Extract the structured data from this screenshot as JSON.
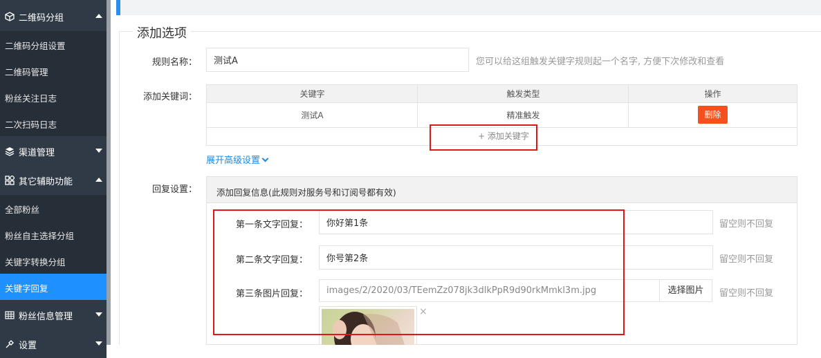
{
  "sidebar": {
    "groups": [
      {
        "label": "二维码分组",
        "icon": "cube-icon",
        "expanded": true
      },
      {
        "label": "渠道管理",
        "icon": "layers-icon",
        "expanded": false
      },
      {
        "label": "其它辅助功能",
        "icon": "apps-icon",
        "expanded": true
      },
      {
        "label": "粉丝信息管理",
        "icon": "table-icon",
        "expanded": false
      },
      {
        "label": "设置",
        "icon": "tools-icon",
        "expanded": false
      }
    ],
    "items_group1": [
      "二维码分组设置",
      "二维码管理",
      "粉丝关注日志",
      "二次扫码日志"
    ],
    "items_group3": [
      "全部粉丝",
      "粉丝自主选择分组",
      "关键字转换分组",
      "关键字回复"
    ],
    "active_item": "关键字回复"
  },
  "form": {
    "legend": "添加选项",
    "rule_name_label": "规则名称：",
    "rule_name_value": "测试A",
    "rule_name_hint": "您可以给这组触发关键字规则起一个名字, 方便下次修改和查看",
    "keywords_label": "添加关键词：",
    "keywords_table": {
      "headers": [
        "关键字",
        "触发类型",
        "操作"
      ],
      "rows": [
        {
          "keyword": "测试A",
          "type": "精准触发",
          "action": "删除"
        }
      ],
      "add_label": "+ 添加关键字"
    },
    "advanced_label": "展开高级设置",
    "reply_label": "回复设置：",
    "reply_panel_title": "添加回复信息(此规则对服务号和订阅号都有效)",
    "reply_items": [
      {
        "label": "第一条文字回复：",
        "value": "你好第1条",
        "hint": "留空则不回复"
      },
      {
        "label": "第二条文字回复：",
        "value": "你号第2条",
        "hint": "留空则不回复"
      },
      {
        "label": "第三条图片回复：",
        "value": "images/2/2020/03/TEemZz078jk3dlkPpR9d90rkMmkl3m.jpg",
        "hint": "留空则不回复"
      }
    ],
    "pick_image_label": "选择图片",
    "close_glyph": "×"
  },
  "colors": {
    "sidebar_bg": "#2f3a46",
    "sidebar_sub_bg": "#262e38",
    "active": "#1e90ff",
    "danger": "#f4511e",
    "link": "#1e88e5",
    "highlight": "#e0161b"
  }
}
